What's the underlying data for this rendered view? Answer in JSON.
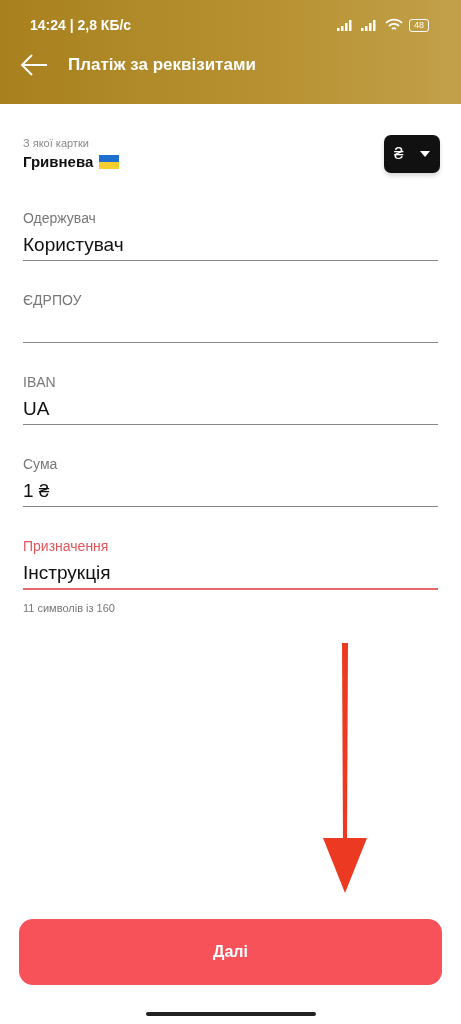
{
  "status_bar": {
    "time": "14:24 | 2,8 КБ/с",
    "battery": "48"
  },
  "app_bar": {
    "title": "Платіж за реквізитами"
  },
  "card": {
    "label": "З якої картки",
    "value": "Гривнева",
    "currency": "₴"
  },
  "fields": [
    {
      "label": "Одержувач",
      "value": "Користувач",
      "focused": false
    },
    {
      "label": "ЄДРПОУ",
      "focused": false
    },
    {
      "label": "IBAN",
      "value": "UA",
      "focused": false
    },
    {
      "label": "Сума",
      "value": "1 ₴",
      "focused": false
    },
    {
      "label": "Призначення",
      "value": "Інструкція",
      "focused": true,
      "helper": "11 символів із 160"
    }
  ],
  "button": "Далі"
}
